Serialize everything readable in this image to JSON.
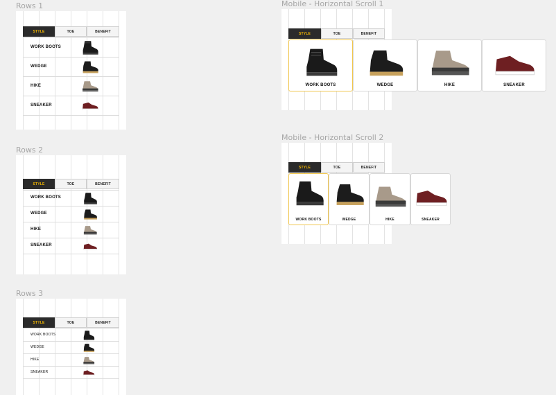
{
  "frames": {
    "rows1": "Rows 1",
    "rows2": "Rows 2",
    "rows3": "Rows 3",
    "mobile1": "Mobile - Horizontal Scroll 1",
    "mobile2": "Mobile - Horizontal Scroll 2"
  },
  "tabs": [
    "STYLE",
    "TOE",
    "BENEFIT"
  ],
  "tabs_active_index": 0,
  "items": [
    "WORK BOOTS",
    "WEDGE",
    "HIKE",
    "SNEAKER"
  ],
  "selected_item_index": 0,
  "colors": {
    "accent_yellow": "#f5b800",
    "selected_border": "#f0c64e",
    "tab_active_bg": "#2b2b2b",
    "boot_black": "#1a1a1a",
    "hike_tan": "#a89a8a",
    "sneaker_maroon": "#6e1f22"
  },
  "icons": [
    "work-boot-image",
    "wedge-boot-image",
    "hike-boot-image",
    "sneaker-image"
  ]
}
